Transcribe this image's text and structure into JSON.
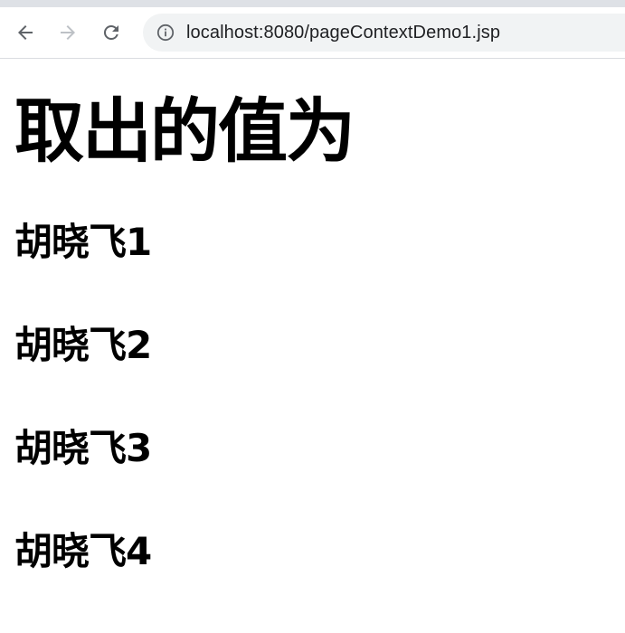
{
  "browser": {
    "url": "localhost:8080/pageContextDemo1.jsp",
    "icons": {
      "back": "back-arrow-icon",
      "forward": "forward-arrow-icon",
      "reload": "reload-icon",
      "info": "info-icon"
    },
    "colors": {
      "strip": "#dee1e6",
      "omnibox_bg": "#f1f3f4",
      "icon_active": "#5f6368",
      "icon_disabled": "#bdc1c6"
    }
  },
  "page": {
    "heading": "取出的值为",
    "values": [
      "胡晓飞1",
      "胡晓飞2",
      "胡晓飞3",
      "胡晓飞4"
    ]
  }
}
